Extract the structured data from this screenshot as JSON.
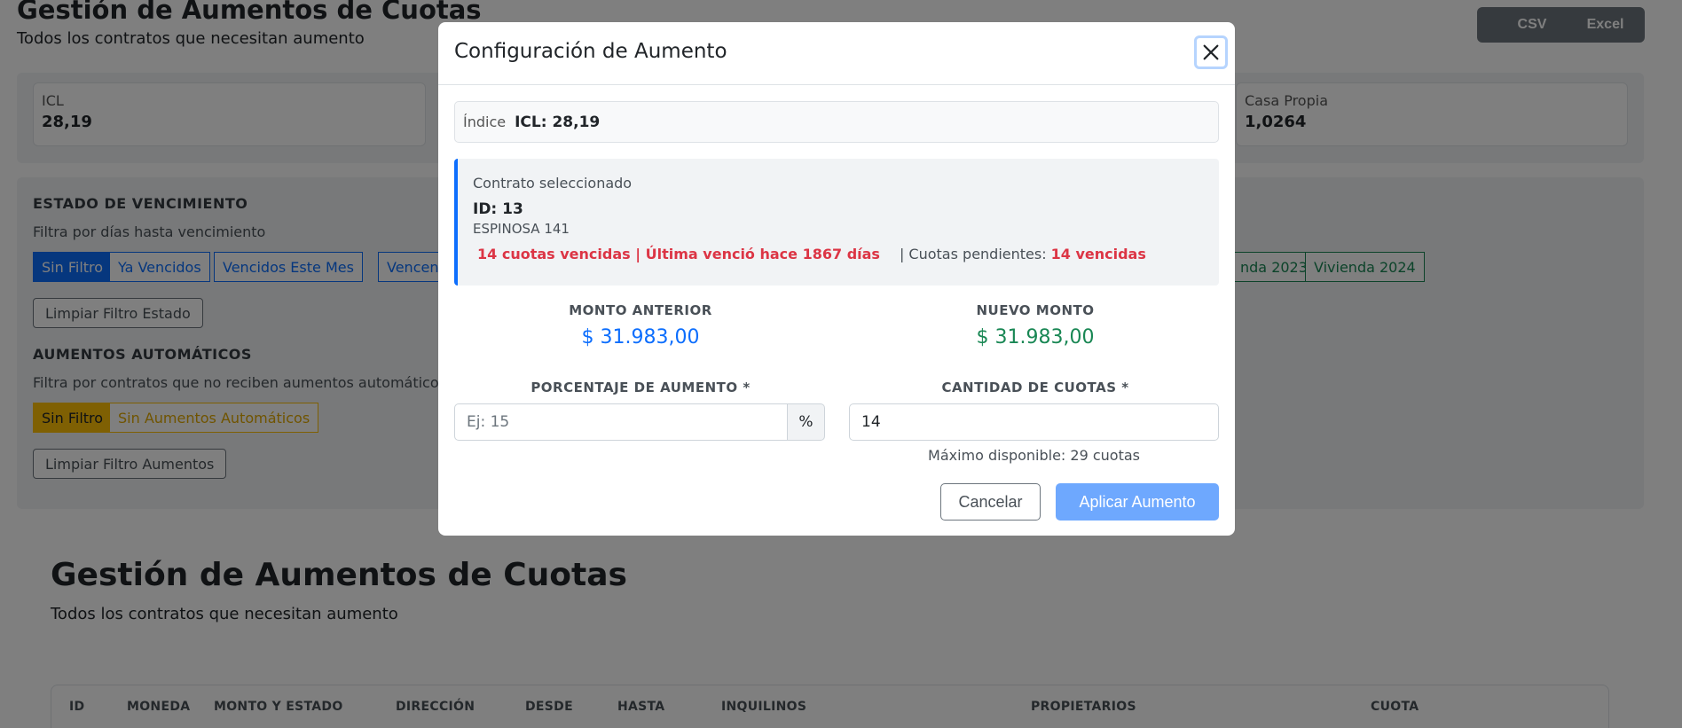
{
  "page": {
    "title": "Gestión de Aumentos de Cuotas",
    "subtitle": "Todos los contratos que necesitan aumento",
    "export_csv": "CSV",
    "export_excel": "Excel"
  },
  "indices": [
    {
      "label": "ICL",
      "value": "28,19"
    },
    {
      "label": "Casa Propia",
      "value": "1,0264"
    }
  ],
  "filters": {
    "vencimiento": {
      "title": "ESTADO DE VENCIMIENTO",
      "description": "Filtra por días hasta vencimiento",
      "chips": [
        "Sin Filtro",
        "Ya Vencidos",
        "Vencidos Este Mes",
        "Vencen"
      ],
      "clear_label": "Limpiar Filtro Estado"
    },
    "vivienda_chips": [
      "nda 2023",
      "Vivienda 2024"
    ],
    "automaticos": {
      "title": "AUMENTOS AUTOMÁTICOS",
      "description": "Filtra por contratos que no reciben aumentos automáticos",
      "chips": [
        "Sin Filtro",
        "Sin Aumentos Automáticos"
      ],
      "clear_label": "Limpiar Filtro Aumentos"
    }
  },
  "lower": {
    "title": "Gestión de Aumentos de Cuotas",
    "subtitle": "Todos los contratos que necesitan aumento",
    "columns": [
      "ID",
      "MONEDA",
      "MONTO Y ESTADO",
      "DIRECCIÓN",
      "DESDE",
      "HASTA",
      "INQUILINOS",
      "PROPIETARIOS",
      "CUOTA"
    ]
  },
  "modal": {
    "title": "Configuración de Aumento",
    "index_label": "Índice",
    "index_value": "ICL: 28,19",
    "contract": {
      "label": "Contrato seleccionado",
      "id": "ID: 13",
      "address": "ESPINOSA 141",
      "status_alert": "14 cuotas vencidas | Última venció hace 1867 días",
      "pending_label": "| Cuotas pendientes:",
      "pending_value": "14 vencidas"
    },
    "monto_anterior_label": "MONTO ANTERIOR",
    "monto_anterior_value": "$ 31.983,00",
    "nuevo_monto_label": "NUEVO MONTO",
    "nuevo_monto_value": "$ 31.983,00",
    "porcentaje_label": "PORCENTAJE DE AUMENTO *",
    "porcentaje_placeholder": "Ej: 15",
    "porcentaje_unit": "%",
    "cuotas_label": "CANTIDAD DE CUOTAS *",
    "cuotas_value": "14",
    "cuotas_hint": "Máximo disponible: 29 cuotas",
    "cancel_label": "Cancelar",
    "apply_label": "Aplicar Aumento"
  },
  "colors": {
    "primary": "#0d6efd",
    "success": "#198754",
    "danger": "#dc3545",
    "warning": "#ffc107",
    "apply_disabled": "#6ea8fe"
  }
}
